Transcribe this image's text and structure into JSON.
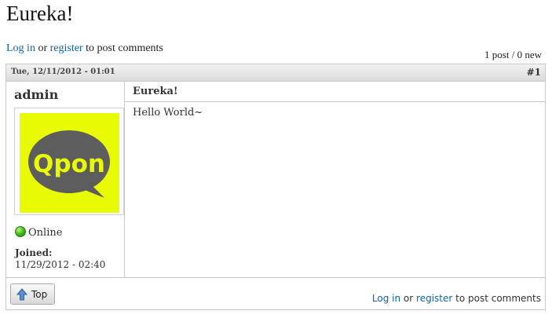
{
  "page": {
    "title": "Eureka!"
  },
  "auth_notice": {
    "login_label": "Log in",
    "or_text": "or",
    "register_label": "register",
    "suffix_text": "to post comments"
  },
  "stats": {
    "counts_text": "1 post / 0 new"
  },
  "post": {
    "date": "Tue, 12/11/2012 - 01:01",
    "number": "#1",
    "author": {
      "name": "admin",
      "avatar_text": "Qpon",
      "avatar_bg_color": "#e8fb04",
      "status": "Online",
      "joined_label": "Joined:",
      "joined_date": "11/29/2012 - 02:40"
    },
    "subject": "Eureka!",
    "body": "Hello World~"
  },
  "footer": {
    "top_button_label": "Top",
    "login_label": "Log in",
    "or_text": "or",
    "register_label": "register",
    "suffix_text": "to post comments"
  },
  "colors": {
    "link": "#0b63a5",
    "border": "#c8c8c8",
    "avatar_bubble": "#5d5d5d",
    "avatar_text": "#e8fb04",
    "online": "#4cbf1d"
  },
  "icons": {
    "online": "online-status-icon",
    "top_arrow": "arrow-up-icon"
  }
}
